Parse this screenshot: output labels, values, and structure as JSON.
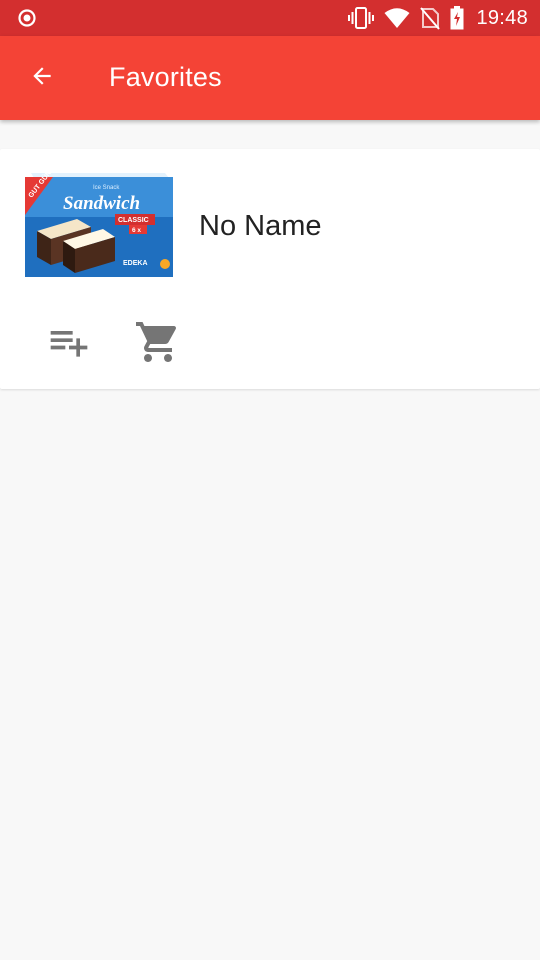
{
  "status_bar": {
    "time": "19:48",
    "background": "#d32f2f",
    "icons": [
      "record-icon",
      "vibrate-icon",
      "wifi-icon",
      "no-sim-icon",
      "battery-charging-icon"
    ]
  },
  "app_bar": {
    "title": "Favorites",
    "background": "#f44336",
    "back_icon": "arrow-back-icon"
  },
  "favorites": [
    {
      "name": "No Name",
      "image": {
        "brand": "GUT GÜNSTIG",
        "tagline": "Ice Snack",
        "product": "Sandwich",
        "variant": "CLASSIC",
        "pack": "6 x",
        "retailer": "EDEKA"
      },
      "actions": [
        "playlist-add-icon",
        "shopping-cart-icon"
      ]
    }
  ]
}
